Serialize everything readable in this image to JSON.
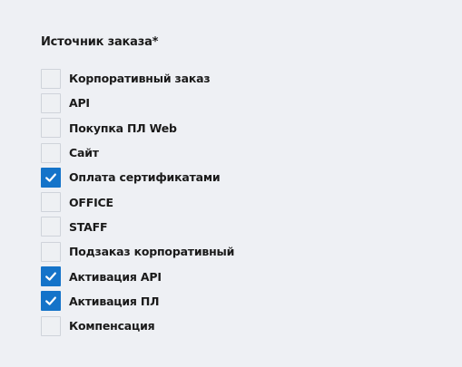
{
  "field": {
    "title": "Источник заказа*"
  },
  "colors": {
    "background": "#eef0f4",
    "checked": "#1473c9",
    "unchecked_border": "#cfd3da",
    "text": "#1a1a1a"
  },
  "options": [
    {
      "label": "Корпоративный заказ",
      "checked": false
    },
    {
      "label": "API",
      "checked": false
    },
    {
      "label": "Покупка ПЛ Web",
      "checked": false
    },
    {
      "label": "Сайт",
      "checked": false
    },
    {
      "label": "Оплата сертификатами",
      "checked": true
    },
    {
      "label": "OFFICE",
      "checked": false
    },
    {
      "label": "STAFF",
      "checked": false
    },
    {
      "label": "Подзаказ корпоративный",
      "checked": false
    },
    {
      "label": "Активация API",
      "checked": true
    },
    {
      "label": "Активация ПЛ",
      "checked": true
    },
    {
      "label": "Компенсация",
      "checked": false
    }
  ]
}
